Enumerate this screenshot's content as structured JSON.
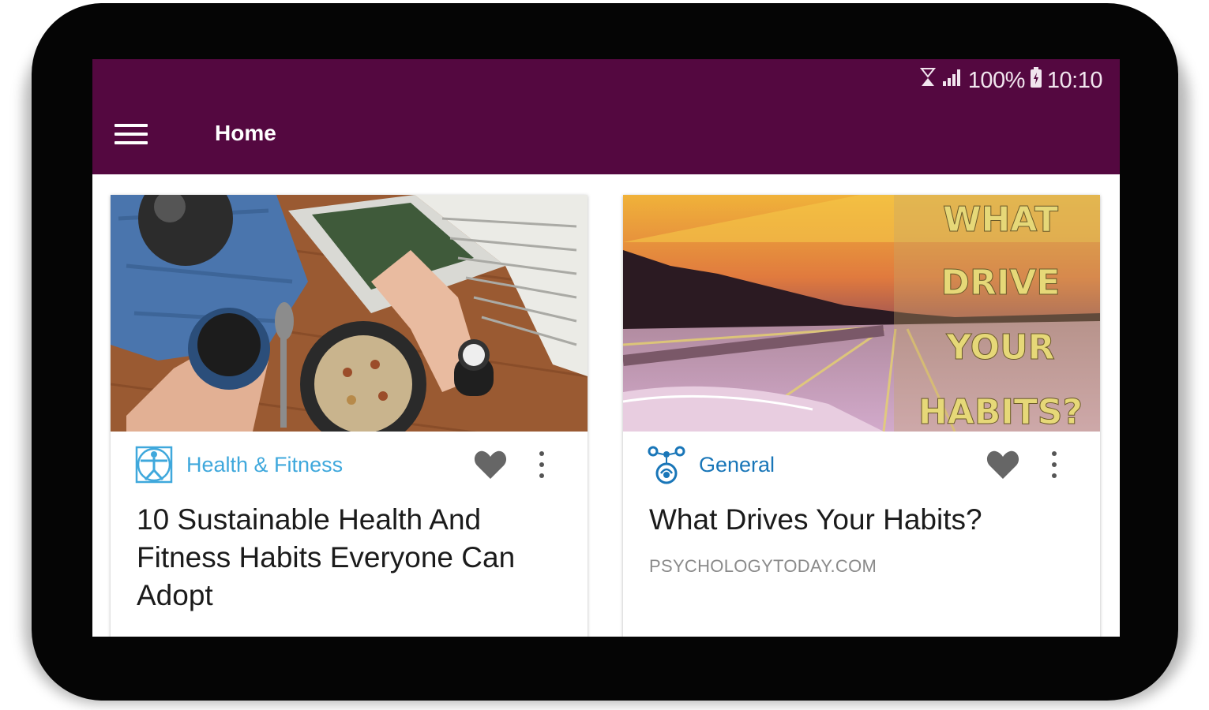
{
  "status_bar": {
    "battery": "100%",
    "time": "10:10"
  },
  "app_bar": {
    "title": "Home",
    "color": "#540840"
  },
  "cards": [
    {
      "category": "Health & Fitness",
      "category_color": "#3fa8dc",
      "title": "10 Sustainable Health And Fitness Habits Everyone Can Adopt",
      "source": ""
    },
    {
      "category": "General",
      "category_color": "#1976b8",
      "title": "What Drives Your Habits?",
      "source": "PSYCHOLOGYTODAY.COM",
      "image_overlay_lines": [
        "WHAT",
        "DRIVE",
        "YOUR",
        "HABITS?"
      ]
    }
  ],
  "icons": {
    "menu": "menu-icon",
    "favorite": "heart-icon",
    "more": "more-vert-icon",
    "wifi_calling": "wifi-calling-icon",
    "signal": "signal-icon",
    "battery": "battery-icon"
  }
}
